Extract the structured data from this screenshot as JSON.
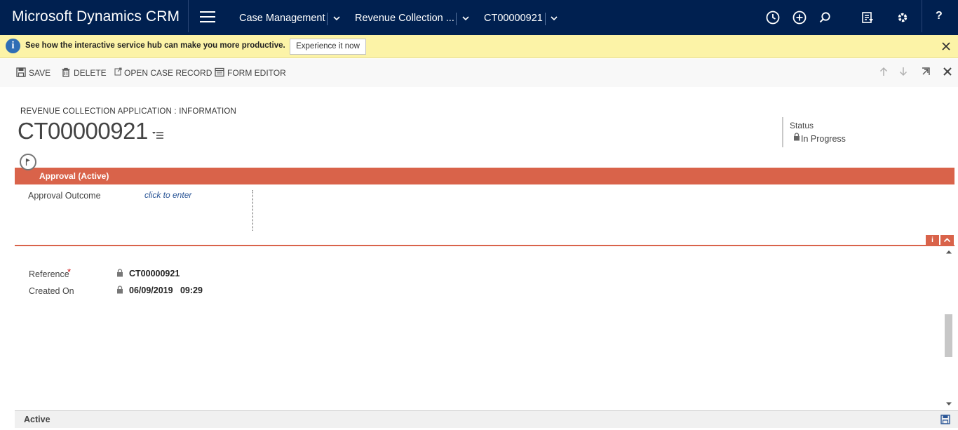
{
  "app": {
    "title": "Microsoft Dynamics CRM"
  },
  "nav": {
    "items": [
      {
        "label": "Case Management"
      },
      {
        "label": "Revenue Collection ..."
      },
      {
        "label": "CT00000921"
      }
    ],
    "help": "?"
  },
  "infobar": {
    "message": "See how the interactive service hub can make you more productive.",
    "button": "Experience it now"
  },
  "commands": {
    "save": "SAVE",
    "delete": "DELETE",
    "open_case": "OPEN CASE RECORD",
    "form_editor": "FORM EDITOR"
  },
  "header": {
    "entity": "REVENUE COLLECTION APPLICATION : INFORMATION",
    "title": "CT00000921",
    "status_label": "Status",
    "status_value": "In Progress"
  },
  "process": {
    "stage": "Approval (Active)",
    "field_label": "Approval Outcome",
    "field_placeholder": "click to enter",
    "info_tab": "i"
  },
  "form": {
    "reference_label": "Reference",
    "reference_required": "*",
    "reference_value": "CT00000921",
    "created_on_label": "Created On",
    "created_on_value": "06/09/2019   09:29"
  },
  "footer": {
    "status": "Active"
  },
  "colors": {
    "nav_bg": "#002050",
    "infobar_bg": "#fcf3a7",
    "stage_accent": "#d9634a",
    "link": "#2a5596"
  }
}
